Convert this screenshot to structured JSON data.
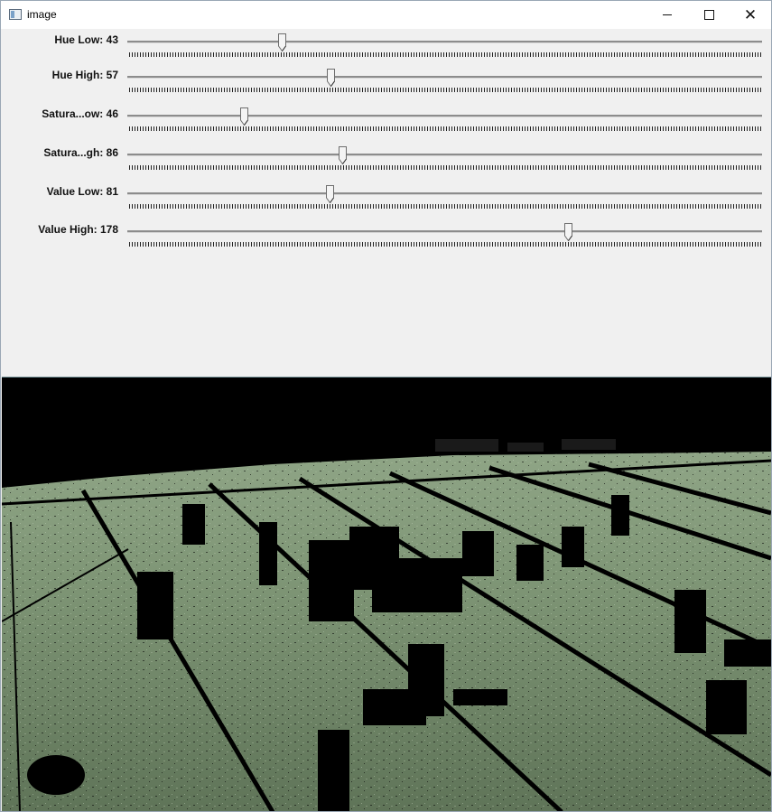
{
  "window": {
    "title": "image",
    "icon": "app-window-icon",
    "controls": [
      "minimize-icon",
      "maximize-icon",
      "close-icon"
    ]
  },
  "trackbars": [
    {
      "label": "Hue Low: 43",
      "value": 43,
      "max": 179
    },
    {
      "label": "Hue High: 57",
      "value": 57,
      "max": 179
    },
    {
      "label": "Satura...ow: 46",
      "value": 46,
      "max": 255
    },
    {
      "label": "Satura...gh: 86",
      "value": 86,
      "max": 255
    },
    {
      "label": "Value Low: 81",
      "value": 81,
      "max": 255
    },
    {
      "label": "Value High: 178",
      "value": 178,
      "max": 255
    }
  ],
  "image": {
    "content": "HSV-thresholded football field mask",
    "colors": {
      "field": "#6f8467",
      "field_light": "#8fa586",
      "mask": "#000000"
    }
  }
}
